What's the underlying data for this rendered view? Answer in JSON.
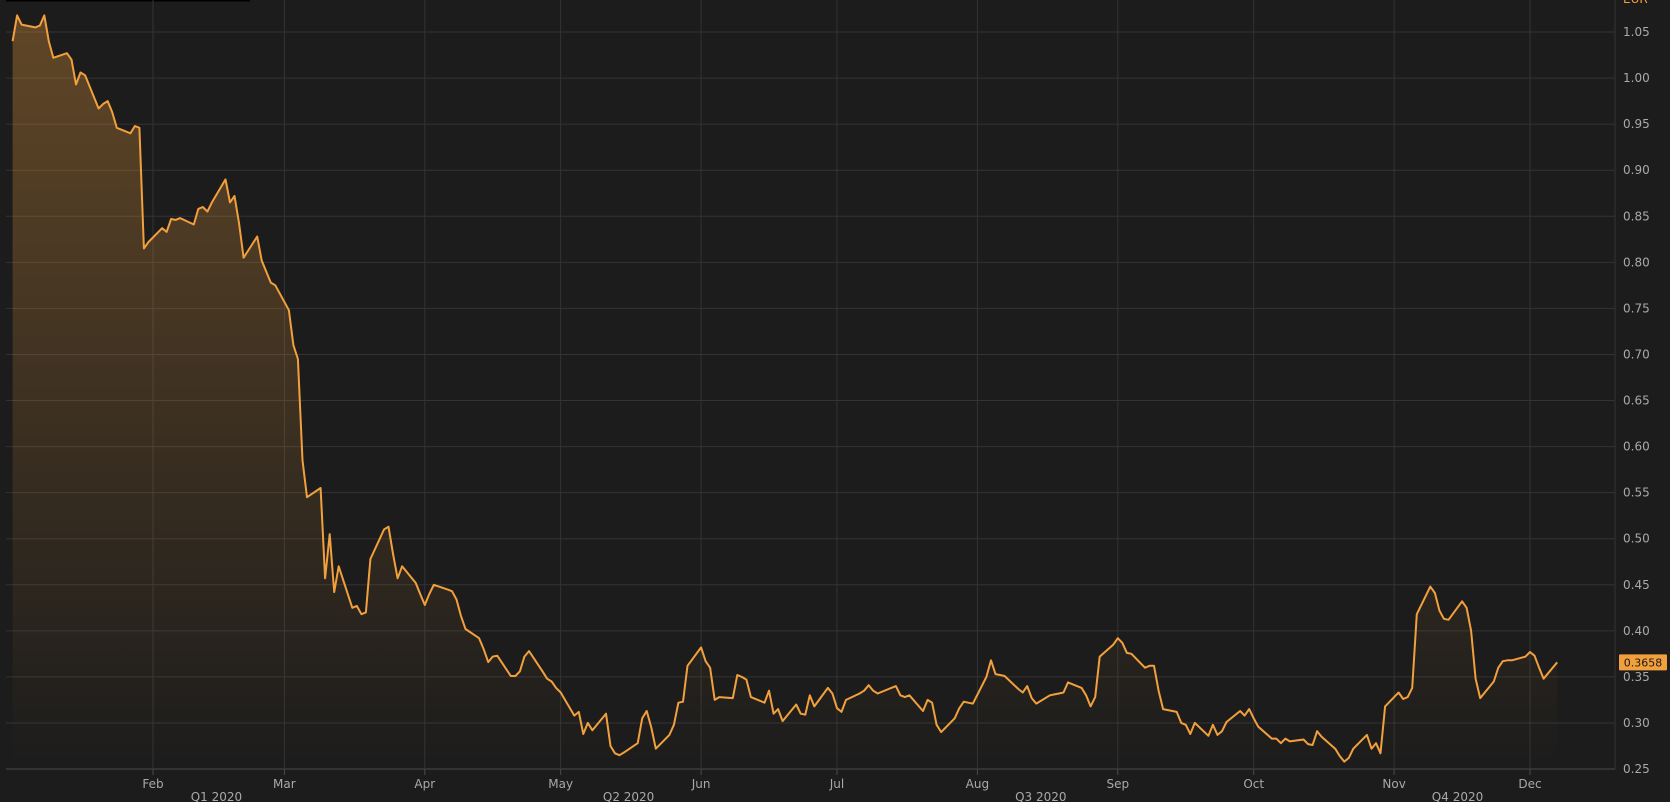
{
  "chart_data": {
    "type": "area",
    "y_axis": {
      "position": "right",
      "ylim": [
        0.25,
        1.05
      ],
      "ticks": [
        "1.05",
        "1.00",
        "0.95",
        "0.90",
        "0.85",
        "0.80",
        "0.75",
        "0.70",
        "0.65",
        "0.60",
        "0.55",
        "0.50",
        "0.45",
        "0.40",
        "0.35",
        "0.30",
        "0.25"
      ],
      "top_label": "EUR"
    },
    "x_axis": {
      "month_labels": [
        {
          "date": "2020-02-01",
          "label": "Feb"
        },
        {
          "date": "2020-03-01",
          "label": "Mar"
        },
        {
          "date": "2020-04-01",
          "label": "Apr"
        },
        {
          "date": "2020-05-01",
          "label": "May"
        },
        {
          "date": "2020-06-01",
          "label": "Jun"
        },
        {
          "date": "2020-07-01",
          "label": "Jul"
        },
        {
          "date": "2020-08-01",
          "label": "Aug"
        },
        {
          "date": "2020-09-01",
          "label": "Sep"
        },
        {
          "date": "2020-10-01",
          "label": "Oct"
        },
        {
          "date": "2020-11-01",
          "label": "Nov"
        },
        {
          "date": "2020-12-01",
          "label": "Dec"
        }
      ],
      "quarter_labels": [
        {
          "date": "2020-02-15",
          "label": "Q1 2020"
        },
        {
          "date": "2020-05-16",
          "label": "Q2 2020"
        },
        {
          "date": "2020-08-15",
          "label": "Q3 2020"
        },
        {
          "date": "2020-11-15",
          "label": "Q4 2020"
        }
      ],
      "xlim": [
        "2020-01-01",
        "2020-12-24"
      ]
    },
    "grid": true,
    "series": [
      {
        "color": "#f2a03d",
        "last_value_label": "0.3658",
        "points": [
          [
            "2020-01-01",
            1.04
          ],
          [
            "2020-01-02",
            1.068
          ],
          [
            "2020-01-03",
            1.058
          ],
          [
            "2020-01-06",
            1.055
          ],
          [
            "2020-01-07",
            1.057
          ],
          [
            "2020-01-08",
            1.068
          ],
          [
            "2020-01-09",
            1.04
          ],
          [
            "2020-01-10",
            1.022
          ],
          [
            "2020-01-13",
            1.027
          ],
          [
            "2020-01-14",
            1.02
          ],
          [
            "2020-01-15",
            0.993
          ],
          [
            "2020-01-16",
            1.006
          ],
          [
            "2020-01-17",
            1.003
          ],
          [
            "2020-01-20",
            0.967
          ],
          [
            "2020-01-21",
            0.972
          ],
          [
            "2020-01-22",
            0.975
          ],
          [
            "2020-01-23",
            0.963
          ],
          [
            "2020-01-24",
            0.946
          ],
          [
            "2020-01-27",
            0.94
          ],
          [
            "2020-01-28",
            0.948
          ],
          [
            "2020-01-29",
            0.946
          ],
          [
            "2020-01-30",
            0.815
          ],
          [
            "2020-01-31",
            0.822
          ],
          [
            "2020-02-03",
            0.837
          ],
          [
            "2020-02-04",
            0.833
          ],
          [
            "2020-02-05",
            0.847
          ],
          [
            "2020-02-06",
            0.846
          ],
          [
            "2020-02-07",
            0.848
          ],
          [
            "2020-02-10",
            0.841
          ],
          [
            "2020-02-11",
            0.858
          ],
          [
            "2020-02-12",
            0.86
          ],
          [
            "2020-02-13",
            0.855
          ],
          [
            "2020-02-14",
            0.865
          ],
          [
            "2020-02-17",
            0.89
          ],
          [
            "2020-02-18",
            0.865
          ],
          [
            "2020-02-19",
            0.872
          ],
          [
            "2020-02-20",
            0.842
          ],
          [
            "2020-02-21",
            0.805
          ],
          [
            "2020-02-24",
            0.828
          ],
          [
            "2020-02-25",
            0.802
          ],
          [
            "2020-02-26",
            0.79
          ],
          [
            "2020-02-27",
            0.778
          ],
          [
            "2020-02-28",
            0.775
          ],
          [
            "2020-03-02",
            0.748
          ],
          [
            "2020-03-03",
            0.71
          ],
          [
            "2020-03-04",
            0.695
          ],
          [
            "2020-03-05",
            0.585
          ],
          [
            "2020-03-06",
            0.545
          ],
          [
            "2020-03-09",
            0.555
          ],
          [
            "2020-03-10",
            0.457
          ],
          [
            "2020-03-11",
            0.505
          ],
          [
            "2020-03-12",
            0.442
          ],
          [
            "2020-03-13",
            0.47
          ],
          [
            "2020-03-16",
            0.425
          ],
          [
            "2020-03-17",
            0.427
          ],
          [
            "2020-03-18",
            0.418
          ],
          [
            "2020-03-19",
            0.42
          ],
          [
            "2020-03-20",
            0.478
          ],
          [
            "2020-03-23",
            0.51
          ],
          [
            "2020-03-24",
            0.513
          ],
          [
            "2020-03-25",
            0.483
          ],
          [
            "2020-03-26",
            0.457
          ],
          [
            "2020-03-27",
            0.47
          ],
          [
            "2020-03-30",
            0.452
          ],
          [
            "2020-03-31",
            0.44
          ],
          [
            "2020-04-01",
            0.428
          ],
          [
            "2020-04-02",
            0.44
          ],
          [
            "2020-04-03",
            0.45
          ],
          [
            "2020-04-06",
            0.445
          ],
          [
            "2020-04-07",
            0.443
          ],
          [
            "2020-04-08",
            0.434
          ],
          [
            "2020-04-09",
            0.416
          ],
          [
            "2020-04-10",
            0.402
          ],
          [
            "2020-04-13",
            0.392
          ],
          [
            "2020-04-14",
            0.38
          ],
          [
            "2020-04-15",
            0.366
          ],
          [
            "2020-04-16",
            0.372
          ],
          [
            "2020-04-17",
            0.373
          ],
          [
            "2020-04-20",
            0.351
          ],
          [
            "2020-04-21",
            0.351
          ],
          [
            "2020-04-22",
            0.356
          ],
          [
            "2020-04-23",
            0.372
          ],
          [
            "2020-04-24",
            0.378
          ],
          [
            "2020-04-27",
            0.356
          ],
          [
            "2020-04-28",
            0.348
          ],
          [
            "2020-04-29",
            0.345
          ],
          [
            "2020-04-30",
            0.338
          ],
          [
            "2020-05-01",
            0.333
          ],
          [
            "2020-05-04",
            0.308
          ],
          [
            "2020-05-05",
            0.312
          ],
          [
            "2020-05-06",
            0.288
          ],
          [
            "2020-05-07",
            0.3
          ],
          [
            "2020-05-08",
            0.292
          ],
          [
            "2020-05-11",
            0.31
          ],
          [
            "2020-05-12",
            0.275
          ],
          [
            "2020-05-13",
            0.267
          ],
          [
            "2020-05-14",
            0.265
          ],
          [
            "2020-05-15",
            0.268
          ],
          [
            "2020-05-18",
            0.278
          ],
          [
            "2020-05-19",
            0.305
          ],
          [
            "2020-05-20",
            0.313
          ],
          [
            "2020-05-21",
            0.295
          ],
          [
            "2020-05-22",
            0.272
          ],
          [
            "2020-05-25",
            0.287
          ],
          [
            "2020-05-26",
            0.298
          ],
          [
            "2020-05-27",
            0.322
          ],
          [
            "2020-05-28",
            0.323
          ],
          [
            "2020-05-29",
            0.362
          ],
          [
            "2020-06-01",
            0.382
          ],
          [
            "2020-06-02",
            0.367
          ],
          [
            "2020-06-03",
            0.36
          ],
          [
            "2020-06-04",
            0.325
          ],
          [
            "2020-06-05",
            0.328
          ],
          [
            "2020-06-08",
            0.327
          ],
          [
            "2020-06-09",
            0.352
          ],
          [
            "2020-06-10",
            0.35
          ],
          [
            "2020-06-11",
            0.347
          ],
          [
            "2020-06-12",
            0.328
          ],
          [
            "2020-06-15",
            0.322
          ],
          [
            "2020-06-16",
            0.335
          ],
          [
            "2020-06-17",
            0.31
          ],
          [
            "2020-06-18",
            0.315
          ],
          [
            "2020-06-19",
            0.302
          ],
          [
            "2020-06-22",
            0.32
          ],
          [
            "2020-06-23",
            0.31
          ],
          [
            "2020-06-24",
            0.309
          ],
          [
            "2020-06-25",
            0.33
          ],
          [
            "2020-06-26",
            0.318
          ],
          [
            "2020-06-29",
            0.338
          ],
          [
            "2020-06-30",
            0.332
          ],
          [
            "2020-07-01",
            0.316
          ],
          [
            "2020-07-02",
            0.312
          ],
          [
            "2020-07-03",
            0.325
          ],
          [
            "2020-07-06",
            0.332
          ],
          [
            "2020-07-07",
            0.335
          ],
          [
            "2020-07-08",
            0.341
          ],
          [
            "2020-07-09",
            0.335
          ],
          [
            "2020-07-10",
            0.332
          ],
          [
            "2020-07-13",
            0.338
          ],
          [
            "2020-07-14",
            0.34
          ],
          [
            "2020-07-15",
            0.33
          ],
          [
            "2020-07-16",
            0.328
          ],
          [
            "2020-07-17",
            0.33
          ],
          [
            "2020-07-20",
            0.313
          ],
          [
            "2020-07-21",
            0.325
          ],
          [
            "2020-07-22",
            0.322
          ],
          [
            "2020-07-23",
            0.298
          ],
          [
            "2020-07-24",
            0.29
          ],
          [
            "2020-07-27",
            0.305
          ],
          [
            "2020-07-28",
            0.316
          ],
          [
            "2020-07-29",
            0.323
          ],
          [
            "2020-07-30",
            0.322
          ],
          [
            "2020-07-31",
            0.321
          ],
          [
            "2020-08-03",
            0.35
          ],
          [
            "2020-08-04",
            0.368
          ],
          [
            "2020-08-05",
            0.353
          ],
          [
            "2020-08-06",
            0.352
          ],
          [
            "2020-08-07",
            0.351
          ],
          [
            "2020-08-10",
            0.337
          ],
          [
            "2020-08-11",
            0.333
          ],
          [
            "2020-08-12",
            0.34
          ],
          [
            "2020-08-13",
            0.327
          ],
          [
            "2020-08-14",
            0.321
          ],
          [
            "2020-08-17",
            0.33
          ],
          [
            "2020-08-18",
            0.331
          ],
          [
            "2020-08-19",
            0.332
          ],
          [
            "2020-08-20",
            0.333
          ],
          [
            "2020-08-21",
            0.344
          ],
          [
            "2020-08-24",
            0.338
          ],
          [
            "2020-08-25",
            0.33
          ],
          [
            "2020-08-26",
            0.318
          ],
          [
            "2020-08-27",
            0.328
          ],
          [
            "2020-08-28",
            0.372
          ],
          [
            "2020-08-31",
            0.385
          ],
          [
            "2020-09-01",
            0.392
          ],
          [
            "2020-09-02",
            0.387
          ],
          [
            "2020-09-03",
            0.376
          ],
          [
            "2020-09-04",
            0.375
          ],
          [
            "2020-09-07",
            0.36
          ],
          [
            "2020-09-08",
            0.362
          ],
          [
            "2020-09-09",
            0.362
          ],
          [
            "2020-09-10",
            0.335
          ],
          [
            "2020-09-11",
            0.315
          ],
          [
            "2020-09-14",
            0.312
          ],
          [
            "2020-09-15",
            0.3
          ],
          [
            "2020-09-16",
            0.298
          ],
          [
            "2020-09-17",
            0.288
          ],
          [
            "2020-09-18",
            0.3
          ],
          [
            "2020-09-21",
            0.286
          ],
          [
            "2020-09-22",
            0.298
          ],
          [
            "2020-09-23",
            0.287
          ],
          [
            "2020-09-24",
            0.291
          ],
          [
            "2020-09-25",
            0.301
          ],
          [
            "2020-09-28",
            0.313
          ],
          [
            "2020-09-29",
            0.308
          ],
          [
            "2020-09-30",
            0.315
          ],
          [
            "2020-10-01",
            0.305
          ],
          [
            "2020-10-02",
            0.296
          ],
          [
            "2020-10-05",
            0.283
          ],
          [
            "2020-10-06",
            0.283
          ],
          [
            "2020-10-07",
            0.278
          ],
          [
            "2020-10-08",
            0.283
          ],
          [
            "2020-10-09",
            0.28
          ],
          [
            "2020-10-12",
            0.282
          ],
          [
            "2020-10-13",
            0.277
          ],
          [
            "2020-10-14",
            0.276
          ],
          [
            "2020-10-15",
            0.291
          ],
          [
            "2020-10-16",
            0.285
          ],
          [
            "2020-10-19",
            0.272
          ],
          [
            "2020-10-20",
            0.264
          ],
          [
            "2020-10-21",
            0.258
          ],
          [
            "2020-10-22",
            0.262
          ],
          [
            "2020-10-23",
            0.272
          ],
          [
            "2020-10-26",
            0.287
          ],
          [
            "2020-10-27",
            0.272
          ],
          [
            "2020-10-28",
            0.278
          ],
          [
            "2020-10-29",
            0.267
          ],
          [
            "2020-10-30",
            0.318
          ],
          [
            "2020-11-02",
            0.333
          ],
          [
            "2020-11-03",
            0.326
          ],
          [
            "2020-11-04",
            0.328
          ],
          [
            "2020-11-05",
            0.338
          ],
          [
            "2020-11-06",
            0.418
          ],
          [
            "2020-11-09",
            0.448
          ],
          [
            "2020-11-10",
            0.441
          ],
          [
            "2020-11-11",
            0.422
          ],
          [
            "2020-11-12",
            0.413
          ],
          [
            "2020-11-13",
            0.412
          ],
          [
            "2020-11-16",
            0.432
          ],
          [
            "2020-11-17",
            0.425
          ],
          [
            "2020-11-18",
            0.4
          ],
          [
            "2020-11-19",
            0.348
          ],
          [
            "2020-11-20",
            0.327
          ],
          [
            "2020-11-23",
            0.345
          ],
          [
            "2020-11-24",
            0.36
          ],
          [
            "2020-11-25",
            0.367
          ],
          [
            "2020-11-26",
            0.368
          ],
          [
            "2020-11-27",
            0.368
          ],
          [
            "2020-11-30",
            0.372
          ],
          [
            "2020-12-01",
            0.377
          ],
          [
            "2020-12-02",
            0.373
          ],
          [
            "2020-12-03",
            0.36
          ],
          [
            "2020-12-04",
            0.348
          ],
          [
            "2020-12-07",
            0.3658
          ]
        ]
      }
    ]
  }
}
